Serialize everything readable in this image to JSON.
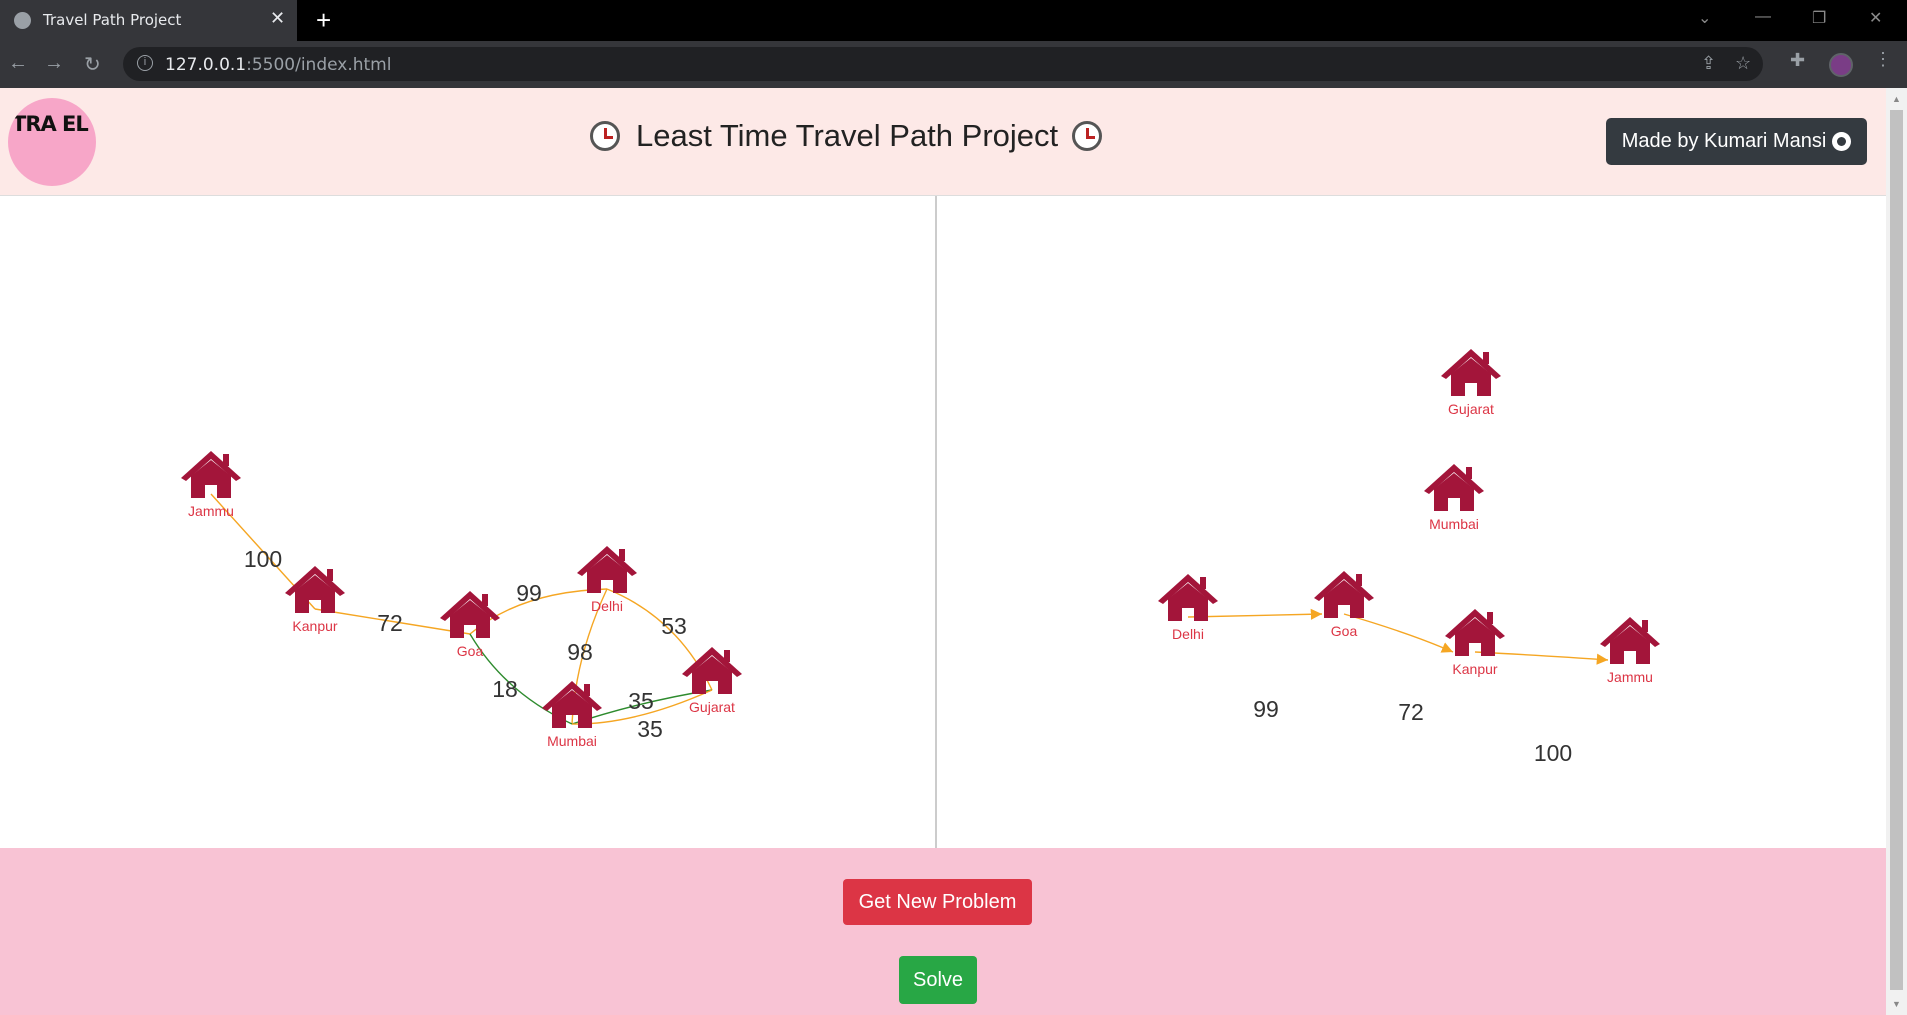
{
  "browser": {
    "tab_title": "Travel Path Project",
    "url_host": "127.0.0.1",
    "url_path": ":5500/index.html"
  },
  "header": {
    "logo_text": "TRA EL",
    "title": "Least Time Travel Path Project",
    "made_by": "Made by Kumari Mansi"
  },
  "left_graph": {
    "nodes": [
      {
        "id": "jammu",
        "label": "Jammu"
      },
      {
        "id": "kanpur",
        "label": "Kanpur"
      },
      {
        "id": "goa",
        "label": "Goa"
      },
      {
        "id": "delhi",
        "label": "Delhi"
      },
      {
        "id": "mumbai",
        "label": "Mumbai"
      },
      {
        "id": "gujarat",
        "label": "Gujarat"
      }
    ],
    "edges": [
      {
        "from": "jammu",
        "to": "kanpur",
        "weight": "100",
        "color": "#f5a623"
      },
      {
        "from": "kanpur",
        "to": "goa",
        "weight": "72",
        "color": "#f5a623"
      },
      {
        "from": "goa",
        "to": "delhi",
        "weight": "99",
        "color": "#f5a623"
      },
      {
        "from": "delhi",
        "to": "gujarat",
        "weight": "53",
        "color": "#f5a623"
      },
      {
        "from": "delhi",
        "to": "mumbai",
        "weight": "98",
        "color": "#f5a623"
      },
      {
        "from": "goa",
        "to": "mumbai",
        "weight": "18",
        "color": "#2e8b2e"
      },
      {
        "from": "mumbai",
        "to": "gujarat",
        "weight": "35",
        "color": "#2e8b2e"
      },
      {
        "from": "mumbai",
        "to": "gujarat",
        "weight": "35",
        "color": "#f5a623"
      }
    ]
  },
  "right_graph": {
    "nodes": [
      {
        "id": "gujarat",
        "label": "Gujarat"
      },
      {
        "id": "mumbai",
        "label": "Mumbai"
      },
      {
        "id": "delhi",
        "label": "Delhi"
      },
      {
        "id": "goa",
        "label": "Goa"
      },
      {
        "id": "kanpur",
        "label": "Kanpur"
      },
      {
        "id": "jammu",
        "label": "Jammu"
      }
    ],
    "edges": [
      {
        "from": "delhi",
        "to": "goa",
        "weight": "99",
        "color": "#f5a623"
      },
      {
        "from": "goa",
        "to": "kanpur",
        "weight": "72",
        "color": "#f5a623"
      },
      {
        "from": "kanpur",
        "to": "jammu",
        "weight": "100",
        "color": "#f5a623"
      }
    ]
  },
  "footer": {
    "new_problem": "Get New Problem",
    "solve": "Solve"
  },
  "colors": {
    "header_bg": "#fde9e7",
    "footer_bg": "#f8c3d4",
    "node": "#a3153a",
    "node_label": "#dc3545"
  }
}
